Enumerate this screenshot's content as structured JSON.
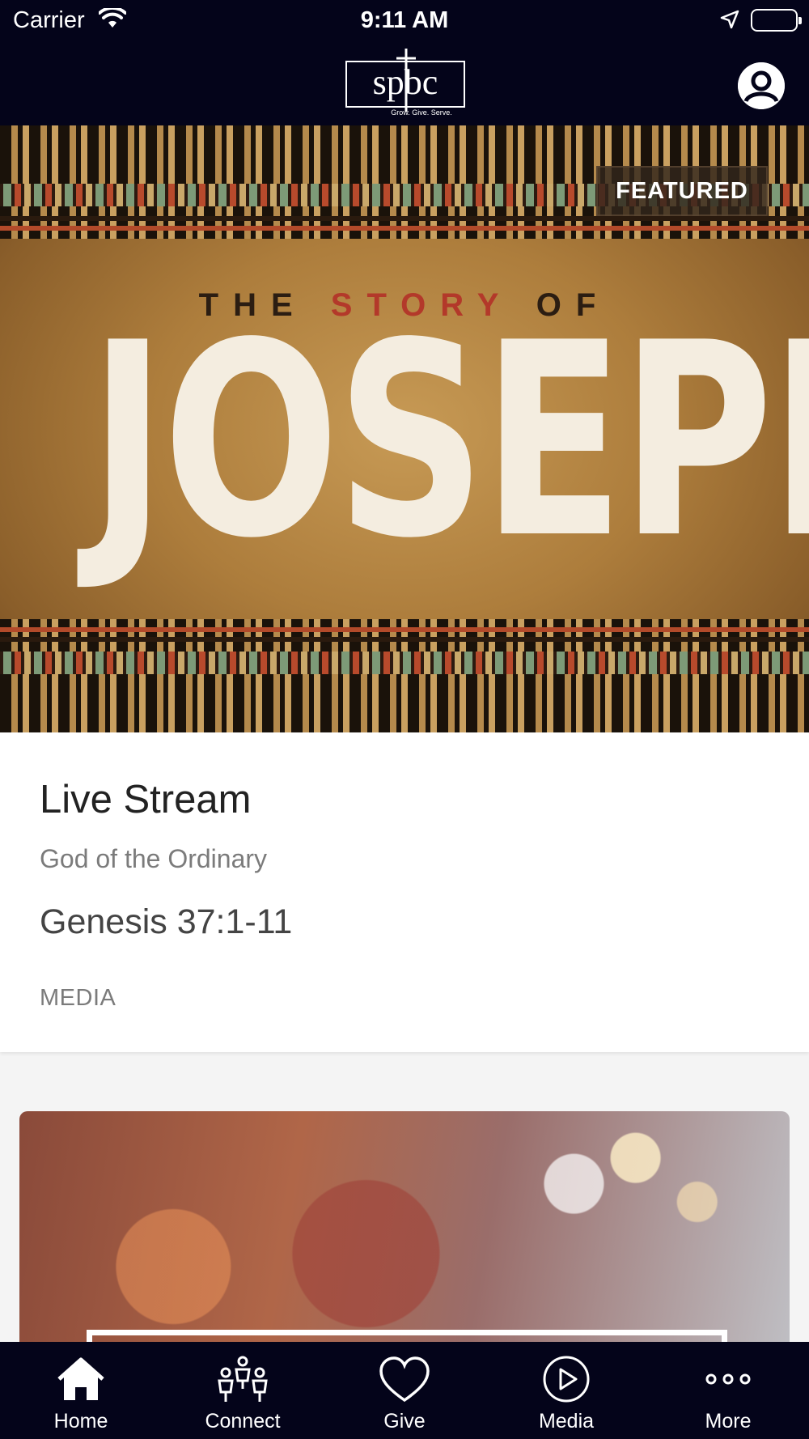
{
  "status_bar": {
    "carrier": "Carrier",
    "time": "9:11 AM"
  },
  "header": {
    "logo_text": "spbc",
    "logo_tagline": "Grow. Give. Serve."
  },
  "hero": {
    "badge": "FEATURED",
    "art_line_1": "THE",
    "art_line_accent": "STORY",
    "art_line_2": "OF",
    "art_title": "JOSEPH"
  },
  "featured_card": {
    "title": "Live Stream",
    "subtitle": "God of the Ordinary",
    "reference": "Genesis 37:1-11",
    "category": "MEDIA"
  },
  "tabs": [
    {
      "label": "Home",
      "icon": "home-icon"
    },
    {
      "label": "Connect",
      "icon": "connect-icon"
    },
    {
      "label": "Give",
      "icon": "heart-icon"
    },
    {
      "label": "Media",
      "icon": "play-icon"
    },
    {
      "label": "More",
      "icon": "more-icon"
    }
  ],
  "colors": {
    "nav_bg": "#04041a",
    "card_bg": "#ffffff",
    "page_bg": "#f4f4f4"
  }
}
